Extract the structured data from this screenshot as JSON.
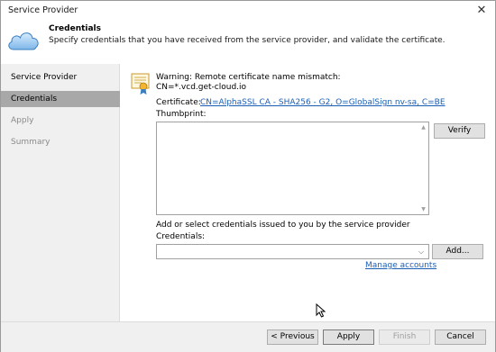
{
  "window": {
    "title": "Service Provider",
    "close_glyph": "✕"
  },
  "header": {
    "title": "Credentials",
    "description": "Specify credentials that you have received from the service provider, and validate the certificate.",
    "icon": "cloud-icon"
  },
  "sidebar": {
    "items": [
      {
        "label": "Service Provider",
        "state": "normal"
      },
      {
        "label": "Credentials",
        "state": "active"
      },
      {
        "label": "Apply",
        "state": "disabled"
      },
      {
        "label": "Summary",
        "state": "disabled"
      }
    ]
  },
  "content": {
    "warning_line1": "Warning: Remote certificate name mismatch:",
    "warning_line2": "CN=*.vcd.get-cloud.io",
    "certificate_label": "Certificate:",
    "certificate_link": "CN=AlphaSSL CA - SHA256 - G2, O=GlobalSign nv-sa, C=BE",
    "thumbprint_label": "Thumbprint:",
    "thumbprint_value": "",
    "verify_button": "Verify",
    "add_label": "Add or select credentials issued to you by the service provider",
    "credentials_label": "Credentials:",
    "credentials_value": "",
    "add_button": "Add...",
    "manage_link": "Manage accounts"
  },
  "footer": {
    "previous_button": "< Previous",
    "apply_button": "Apply",
    "finish_button": "Finish",
    "cancel_button": "Cancel"
  },
  "colors": {
    "link": "#1a5fb4",
    "sidebar_active": "#a8a8a8",
    "panel_bg": "#f0f0f0"
  }
}
